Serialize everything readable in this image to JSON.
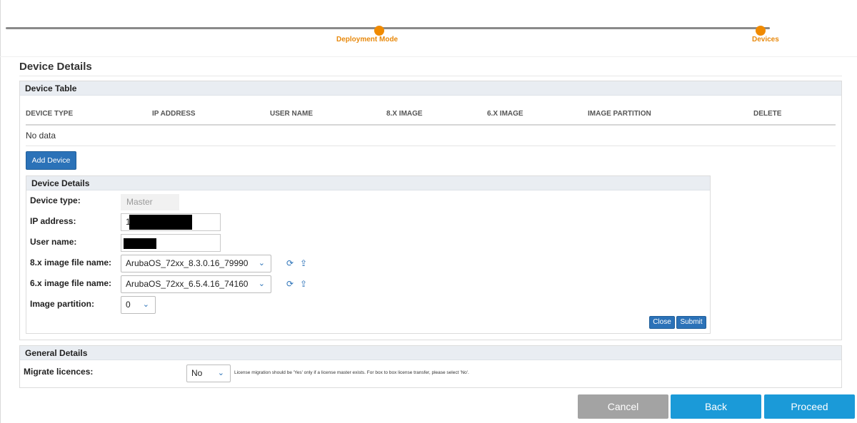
{
  "stepper": {
    "steps": [
      {
        "label": "Deployment Mode"
      },
      {
        "label": "Devices"
      }
    ]
  },
  "page_title": "Device Details",
  "device_table": {
    "title": "Device Table",
    "columns": [
      "DEVICE TYPE",
      "IP ADDRESS",
      "USER NAME",
      "8.X IMAGE",
      "6.X IMAGE",
      "IMAGE PARTITION",
      "DELETE"
    ],
    "empty_text": "No data",
    "add_button": "Add Device"
  },
  "device_details": {
    "title": "Device Details",
    "device_type_label": "Device type:",
    "device_type_value": "Master",
    "ip_label": "IP address:",
    "ip_value": "1",
    "username_label": "User name:",
    "username_value": "",
    "image8_label": "8.x image file name:",
    "image8_value": "ArubaOS_72xx_8.3.0.16_79990",
    "image6_label": "6.x image file name:",
    "image6_value": "ArubaOS_72xx_6.5.4.16_74160",
    "partition_label": "Image partition:",
    "partition_value": "0",
    "close_label": "Close",
    "submit_label": "Submit"
  },
  "general_details": {
    "title": "General Details",
    "migrate_label": "Migrate licences:",
    "migrate_value": "No",
    "note": "License migration should be 'Yes' only if a license master exists. For box to box license transfer, please select 'No'."
  },
  "actions": {
    "cancel": "Cancel",
    "back": "Back",
    "proceed": "Proceed"
  },
  "colors": {
    "accent_orange": "#f08a00",
    "primary_blue": "#2b72b8",
    "action_blue": "#1b9ad8",
    "cancel_gray": "#a3a3a3"
  },
  "icons": {
    "refresh": "refresh-icon",
    "upload": "upload-icon",
    "chevron": "chevron-down-icon"
  }
}
